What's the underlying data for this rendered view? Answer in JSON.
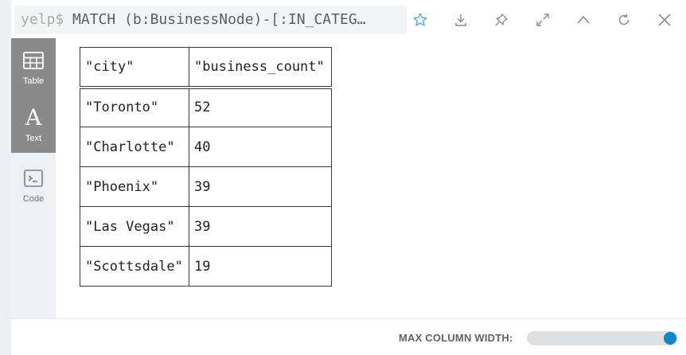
{
  "header": {
    "query_prompt": "yelp$",
    "query_text": "MATCH (b:BusinessNode)-[:IN_CATEG…",
    "icons": [
      "star-icon",
      "download-icon",
      "pin-icon",
      "expand-icon",
      "collapse-icon",
      "rerun-icon",
      "close-icon"
    ]
  },
  "sidebar": {
    "tabs": [
      {
        "label": "Table",
        "icon": "table-icon",
        "active": true
      },
      {
        "label": "Text",
        "icon": "text-icon",
        "active": true
      },
      {
        "label": "Code",
        "icon": "code-icon",
        "active": false
      }
    ]
  },
  "table": {
    "columns": [
      "\"city\"",
      "\"business_count\""
    ],
    "rows": [
      [
        "\"Toronto\"",
        "52"
      ],
      [
        "\"Charlotte\"",
        "40"
      ],
      [
        "\"Phoenix\"",
        "39"
      ],
      [
        "\"Las Vegas\"",
        "39"
      ],
      [
        "\"Scottsdale\"",
        "19"
      ]
    ]
  },
  "footer": {
    "max_column_width_label": "MAX COLUMN WIDTH:",
    "slider_value_fraction": 1.0
  },
  "colors": {
    "accent": "#0d87c7",
    "sidebar_active": "#8a8a8a",
    "star_outline": "#5aa9e6"
  }
}
